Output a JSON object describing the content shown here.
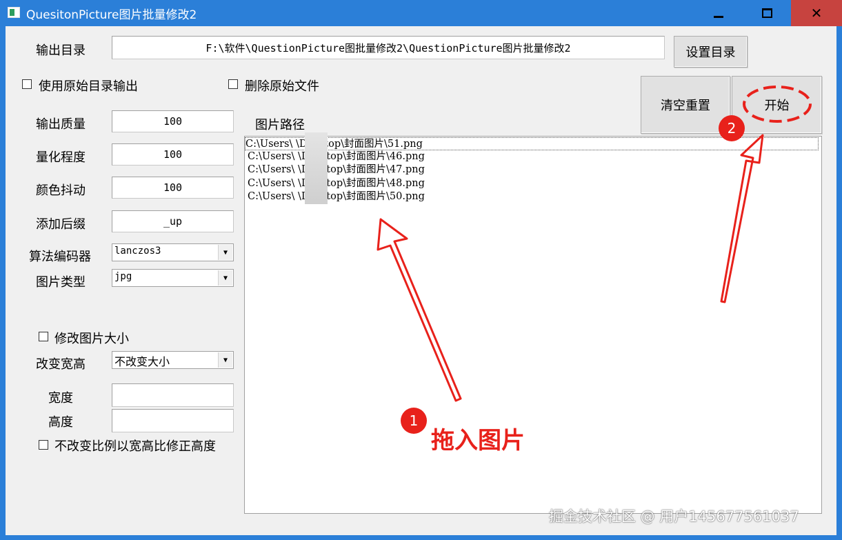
{
  "window": {
    "title": "QuesitonPicture图片批量修改2",
    "controls": {
      "minimize": "minimize",
      "maximize": "maximize",
      "close": "✕"
    }
  },
  "output": {
    "label": "输出目录",
    "path": "F:\\软件\\QuestionPicture图批量修改2\\QuestionPicture图片批量修改2",
    "set_dir_button": "设置目录"
  },
  "options": {
    "use_original_dir": "使用原始目录输出",
    "delete_original": "删除原始文件"
  },
  "buttons": {
    "clear_reset": "清空重置",
    "start": "开始"
  },
  "settings": {
    "quality_label": "输出质量",
    "quality_value": "100",
    "quantize_label": "量化程度",
    "quantize_value": "100",
    "dither_label": "颜色抖动",
    "dither_value": "100",
    "suffix_label": "添加后缀",
    "suffix_value": "_up",
    "codec_label": "算法编码器",
    "codec_value": "lanczos3",
    "type_label": "图片类型",
    "type_value": "jpg"
  },
  "resize": {
    "checkbox": "修改图片大小",
    "change_label": "改变宽高",
    "change_value": "不改变大小",
    "width_label": "宽度",
    "width_value": "",
    "height_label": "高度",
    "height_value": "",
    "keep_ratio": "不改变比例以宽高比修正高度"
  },
  "paths": {
    "label": "图片路径",
    "items": [
      "C:\\Users\\  \\Desktop\\封面图片\\51.png",
      "C:\\Users\\  \\Desktop\\封面图片\\46.png",
      "C:\\Users\\  \\Desktop\\封面图片\\47.png",
      "C:\\Users\\  \\Desktop\\封面图片\\48.png",
      "C:\\Users\\  \\Desktop\\封面图片\\50.png"
    ]
  },
  "annotations": {
    "badge1": "1",
    "drag_text": "拖入图片",
    "badge2": "2",
    "color": "#e8211b"
  },
  "watermark": "掘金技术社区 @ 用户14567756103​7"
}
